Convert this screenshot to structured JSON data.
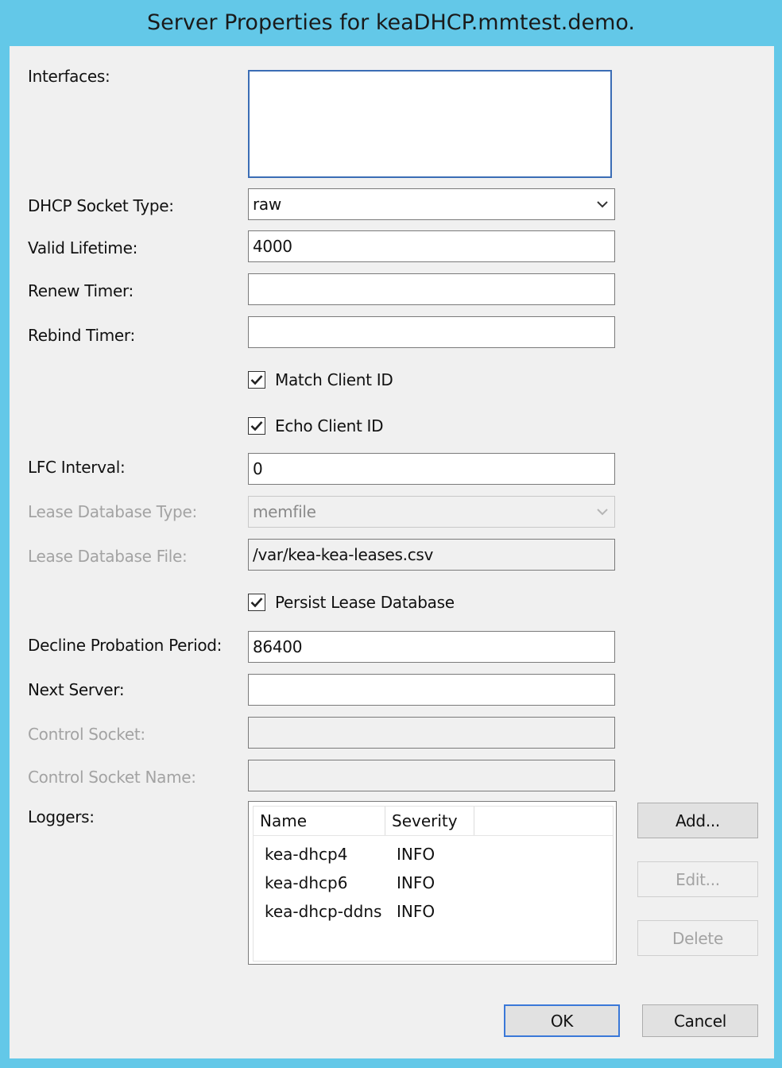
{
  "window": {
    "title": "Server Properties for keaDHCP.mmtest.demo."
  },
  "form": {
    "interfaces_label": "Interfaces:",
    "socket_type_label": "DHCP Socket Type:",
    "socket_type_value": "raw",
    "valid_lifetime_label": "Valid Lifetime:",
    "valid_lifetime_value": "4000",
    "renew_timer_label": "Renew Timer:",
    "renew_timer_value": "",
    "rebind_timer_label": "Rebind Timer:",
    "rebind_timer_value": "",
    "match_client_id_label": "Match Client ID",
    "match_client_id_checked": true,
    "echo_client_id_label": "Echo Client ID",
    "echo_client_id_checked": true,
    "lfc_interval_label": "LFC Interval:",
    "lfc_interval_value": "0",
    "lease_db_type_label": "Lease Database Type:",
    "lease_db_type_value": "memfile",
    "lease_db_file_label": "Lease Database File:",
    "lease_db_file_value": "/var/kea-kea-leases.csv",
    "persist_lease_db_label": "Persist Lease Database",
    "persist_lease_db_checked": true,
    "decline_probation_label": "Decline Probation Period:",
    "decline_probation_value": "86400",
    "next_server_label": "Next Server:",
    "next_server_value": "",
    "control_socket_label": "Control Socket:",
    "control_socket_name_label": "Control Socket Name:",
    "loggers_label": "Loggers:"
  },
  "loggers": {
    "columns": [
      "Name",
      "Severity"
    ],
    "rows": [
      {
        "name": "kea-dhcp4",
        "severity": "INFO"
      },
      {
        "name": "kea-dhcp6",
        "severity": "INFO"
      },
      {
        "name": "kea-dhcp-ddns",
        "severity": "INFO"
      }
    ],
    "add_label": "Add...",
    "edit_label": "Edit...",
    "delete_label": "Delete"
  },
  "footer": {
    "ok_label": "OK",
    "cancel_label": "Cancel"
  }
}
